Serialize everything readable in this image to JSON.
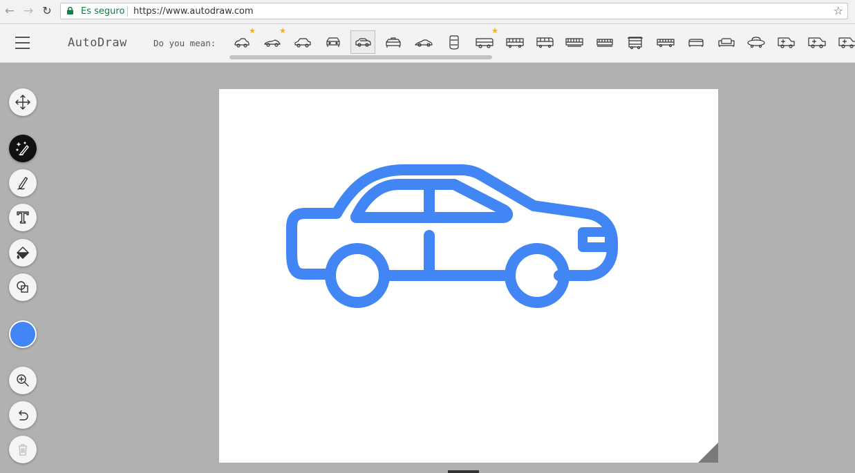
{
  "browser": {
    "back_icon": "←",
    "forward_icon": "→",
    "reload_icon": "↻",
    "secure_label": "Es seguro",
    "url": "https://www.autodraw.com",
    "bookmark_icon": "☆"
  },
  "app": {
    "logo": "AutoDraw",
    "suggestion_label": "Do you mean:",
    "suggestions": [
      {
        "name": "car-outline-suggestion",
        "starred": true,
        "selected": false
      },
      {
        "name": "sports-car-suggestion",
        "starred": true,
        "selected": false
      },
      {
        "name": "sedan-suggestion",
        "starred": false,
        "selected": false
      },
      {
        "name": "car-front-suggestion",
        "starred": false,
        "selected": false
      },
      {
        "name": "car-side-suggestion",
        "starred": false,
        "selected": true
      },
      {
        "name": "taxi-suggestion",
        "starred": false,
        "selected": false
      },
      {
        "name": "racecar-suggestion",
        "starred": false,
        "selected": false
      },
      {
        "name": "car-topview-suggestion",
        "starred": false,
        "selected": false
      },
      {
        "name": "van-suggestion",
        "starred": true,
        "selected": false
      },
      {
        "name": "bus-suggestion",
        "starred": false,
        "selected": false
      },
      {
        "name": "minibus-suggestion",
        "starred": false,
        "selected": false
      },
      {
        "name": "tram-suggestion",
        "starred": false,
        "selected": false
      },
      {
        "name": "train-suggestion",
        "starred": false,
        "selected": false
      },
      {
        "name": "school-bus-suggestion",
        "starred": false,
        "selected": false
      },
      {
        "name": "truck-suggestion",
        "starred": false,
        "selected": false
      },
      {
        "name": "sofa-suggestion",
        "starred": false,
        "selected": false
      },
      {
        "name": "couch-suggestion",
        "starred": false,
        "selected": false
      },
      {
        "name": "ufo-suggestion",
        "starred": false,
        "selected": false
      },
      {
        "name": "ambulance-suggestion",
        "starred": false,
        "selected": false
      },
      {
        "name": "ambulance-2-suggestion",
        "starred": false,
        "selected": false
      },
      {
        "name": "ambulance-3-suggestion",
        "starred": false,
        "selected": false
      }
    ]
  },
  "toolbar": {
    "tools": [
      "move-tool-button",
      "autodraw-tool-button",
      "draw-tool-button",
      "type-tool-button",
      "fill-tool-button",
      "shape-tool-button"
    ],
    "active_tool": "autodraw-tool-button",
    "current_color": "#4285f4",
    "bottom_tools": [
      "zoom-button",
      "undo-button",
      "delete-button"
    ]
  },
  "drawing": {
    "subject": "car",
    "stroke_color": "#4285f4"
  }
}
